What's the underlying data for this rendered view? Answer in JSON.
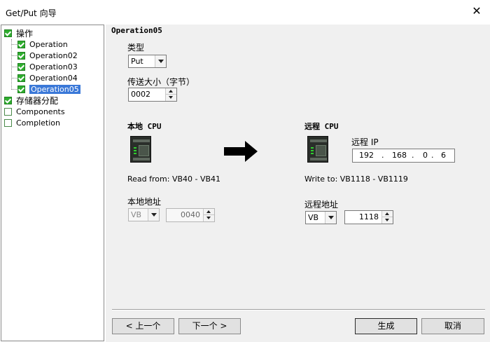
{
  "window": {
    "title": "Get/Put 向导",
    "close_glyph": "✕"
  },
  "tree": {
    "items": [
      {
        "label": "操作",
        "checked": true,
        "level": 0
      },
      {
        "label": "Operation",
        "checked": true,
        "level": 1
      },
      {
        "label": "Operation02",
        "checked": true,
        "level": 1
      },
      {
        "label": "Operation03",
        "checked": true,
        "level": 1
      },
      {
        "label": "Operation04",
        "checked": true,
        "level": 1
      },
      {
        "label": "Operation05",
        "checked": true,
        "level": 1,
        "selected": true
      },
      {
        "label": "存储器分配",
        "checked": true,
        "level": 0
      },
      {
        "label": "Components",
        "checked": false,
        "level": 0
      },
      {
        "label": "Completion",
        "checked": false,
        "level": 0
      }
    ]
  },
  "operation": {
    "title": "Operation05",
    "type_label": "类型",
    "type_value": "Put",
    "size_label": "传送大小（字节）",
    "size_value": "0002"
  },
  "local": {
    "heading": "本地 CPU",
    "read_from": "Read from: VB40 - VB41",
    "address_label": "本地地址",
    "area_value": "VB",
    "offset_value": "0040"
  },
  "remote": {
    "heading": "远程 CPU",
    "ip_label": "远程 IP",
    "ip": [
      "192",
      "168",
      "0",
      "6"
    ],
    "ip_dot": ".",
    "write_to": "Write to: VB1118 - VB1119",
    "address_label": "远程地址",
    "area_value": "VB",
    "offset_value": "1118"
  },
  "buttons": {
    "prev": "< 上一个",
    "next": "下一个 >",
    "finish": "生成",
    "cancel": "取消"
  },
  "colors": {
    "check_green": "#2fae2f",
    "selection_blue": "#3a78d8",
    "panel_bg": "#f0f0f0"
  },
  "icons": {
    "arrow": "right-arrow-icon",
    "cpu": "plc-cpu-icon"
  }
}
